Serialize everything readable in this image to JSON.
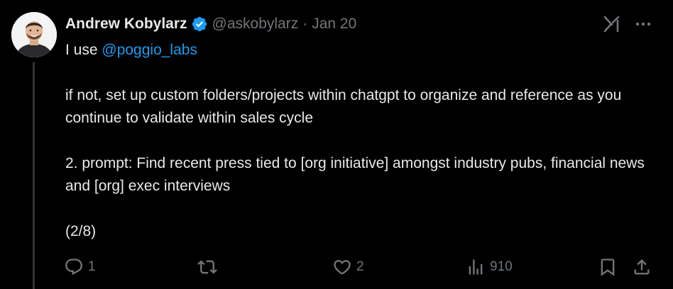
{
  "tweet": {
    "author": {
      "display_name": "Andrew Kobylarz",
      "handle": "@askobylarz",
      "verified": true,
      "avatar": "avatar-photo"
    },
    "separator": "·",
    "date": "Jan 20",
    "body": {
      "prefix": "I use ",
      "mention": "@poggio_labs",
      "paragraphs": [
        "if not, set up custom folders/projects within chatgpt to organize and reference as you continue to validate within sales cycle",
        "2. prompt: Find recent press tied to [org initiative] amongst industry pubs, financial news and [org] exec interviews",
        "(2/8)"
      ]
    },
    "icons": {
      "verified": "verified-badge-icon",
      "grok": "grok-icon",
      "more": "more-icon"
    },
    "actions": {
      "reply": {
        "icon": "reply-icon",
        "count": "1"
      },
      "repost": {
        "icon": "repost-icon",
        "count": ""
      },
      "like": {
        "icon": "like-icon",
        "count": "2"
      },
      "views": {
        "icon": "views-icon",
        "count": "910"
      },
      "bookmark": {
        "icon": "bookmark-icon"
      },
      "share": {
        "icon": "share-icon"
      }
    }
  },
  "colors": {
    "background": "#000000",
    "text": "#e7e9ea",
    "secondary": "#71767b",
    "accent": "#1d9bf0",
    "thread_line": "#333639"
  }
}
